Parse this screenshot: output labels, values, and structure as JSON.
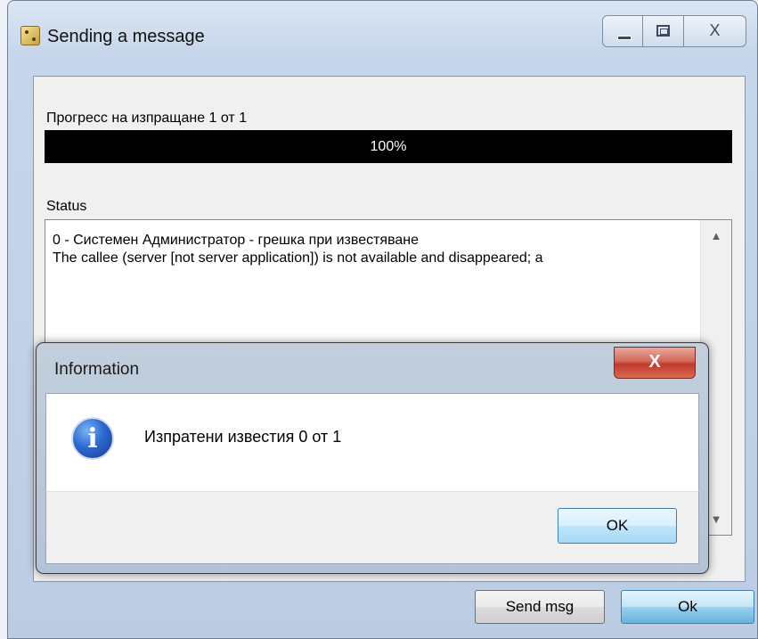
{
  "window": {
    "title": "Sending a message",
    "controls": {
      "minimize": "—",
      "maximize": "□",
      "close": "X"
    }
  },
  "progress": {
    "label": "Прогресс на изпращане 1 от 1",
    "percent_text": "100%",
    "value": 100
  },
  "status": {
    "label": "Status",
    "lines": [
      "0 - Системен Администратор      - грешка при известяване",
      "The callee (server [not server application]) is not available and disappeared; a"
    ],
    "scroll_up": "▲",
    "scroll_down": "▼"
  },
  "buttons": {
    "send_msg": "Send msg",
    "ok": "Ok"
  },
  "dialog": {
    "title": "Information",
    "close_glyph": "X",
    "message": "Изпратени известия 0 от 1",
    "ok": "OK",
    "icon_glyph": "i"
  }
}
